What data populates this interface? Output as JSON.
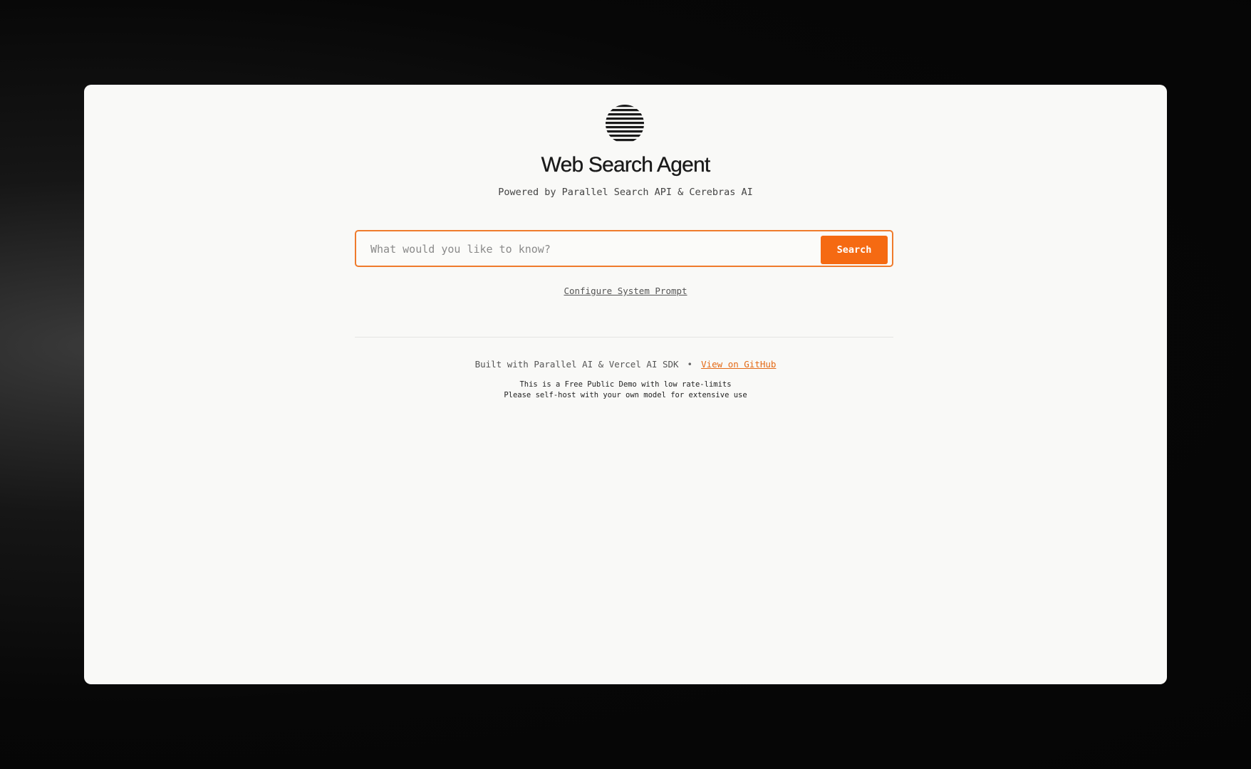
{
  "app": {
    "title": "Web Search Agent",
    "subtitle": "Powered by Parallel Search API & Cerebras AI",
    "logo_icon": "striped-globe-icon"
  },
  "search": {
    "placeholder": "What would you like to know?",
    "value": "",
    "button_label": "Search",
    "accent_color": "#f56a12"
  },
  "config": {
    "link_label": "Configure System Prompt"
  },
  "footer": {
    "built_with": "Built with Parallel AI & Vercel AI SDK",
    "separator": "•",
    "github_label": "View on GitHub",
    "note_line1": "This is a Free Public Demo with low rate-limits",
    "note_line2": "Please self-host with your own model for extensive use"
  }
}
